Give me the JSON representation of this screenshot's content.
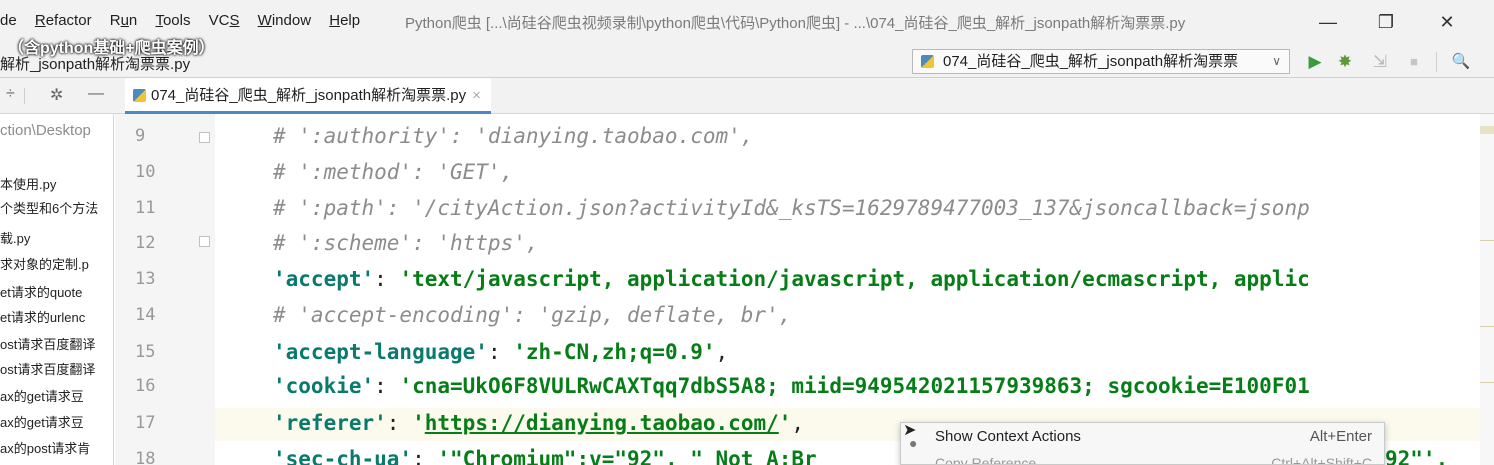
{
  "menu": {
    "items": [
      {
        "text": "de",
        "mnemonic": ""
      },
      {
        "text": "Refactor",
        "mnemonic": "R"
      },
      {
        "text": "Run",
        "mnemonic": "u"
      },
      {
        "text": "Tools",
        "mnemonic": "T"
      },
      {
        "text": "VCS",
        "mnemonic": "S"
      },
      {
        "text": "Window",
        "mnemonic": "W"
      },
      {
        "text": "Help",
        "mnemonic": "H"
      }
    ],
    "window_title": "Python爬虫 [...\\尚硅谷爬虫视频录制\\python爬虫\\代码\\Python爬虫] - ...\\074_尚硅谷_爬虫_解析_jsonpath解析淘票票.py"
  },
  "overlay_text": "（含python基础+爬虫案例）",
  "window_controls": {
    "minimize": "—",
    "restore": "❐",
    "close": "✕"
  },
  "navbar": {
    "breadcrumb": "解析_jsonpath解析淘票票.py",
    "run_config": "074_尚硅谷_爬虫_解析_jsonpath解析淘票票",
    "run_config_arrow": "∨",
    "icons": {
      "run": "▶",
      "debug": "✸",
      "coverage": "⇲",
      "stop": "■",
      "search": "🔍"
    }
  },
  "panel": {
    "collapse": "÷",
    "settings": "✲",
    "hide": "—"
  },
  "tab": {
    "label": "074_尚硅谷_爬虫_解析_jsonpath解析淘票票.py",
    "close": "×"
  },
  "project": {
    "path": "ction\\Desktop",
    "files": [
      "本使用.py",
      "个类型和6个方法",
      "载.py",
      "求对象的定制.p",
      "et请求的quote",
      "et请求的urlenc",
      "ost请求百度翻译",
      "ost请求百度翻译",
      "ax的get请求豆",
      "ax的get请求豆",
      "ax的post请求肯"
    ]
  },
  "line_numbers": [
    "9",
    "10",
    "11",
    "12",
    "13",
    "14",
    "15",
    "16",
    "17",
    "18"
  ],
  "code": {
    "l9": "# ':authority': 'dianying.taobao.com',",
    "l10": "# ':method': 'GET',",
    "l11": "# ':path': '/cityAction.json?activityId&_ksTS=1629789477003_137&jsoncallback=jsonp",
    "l12": "# ':scheme': 'https',",
    "l13_key": "'accept'",
    "l13_sep": ": ",
    "l13_val": "'text/javascript, application/javascript, application/ecmascript, applic",
    "l14": "# 'accept-encoding': 'gzip, deflate, br',",
    "l15_key": "'accept-language'",
    "l15_sep": ": ",
    "l15_val": "'zh-CN,zh;q=0.9'",
    "l15_end": ",",
    "l16_key": "'cookie'",
    "l16_sep": ": ",
    "l16_val": "'cna=UkO6F8VULRwCAXTqq7dbS5A8; miid=949542021157939863; sgcookie=E100F01",
    "l17_key": "'referer'",
    "l17_sep": ": ",
    "l17_q1": "'",
    "l17_url": "https://dianying.taobao.com/",
    "l17_q2": "'",
    "l17_end": ",",
    "l18_key": "'sec-ch-ua'",
    "l18_sep": ": ",
    "l18_val": "'\"Chromium\";v=\"92\", \" Not A;Br",
    "l18_tail": "92\"',"
  },
  "popup": {
    "item1_label": "Show Context Actions",
    "item1_shortcut": "Alt+Enter",
    "item2_label": "Copy Reference",
    "item2_shortcut": "Ctrl+Alt+Shift+C"
  }
}
